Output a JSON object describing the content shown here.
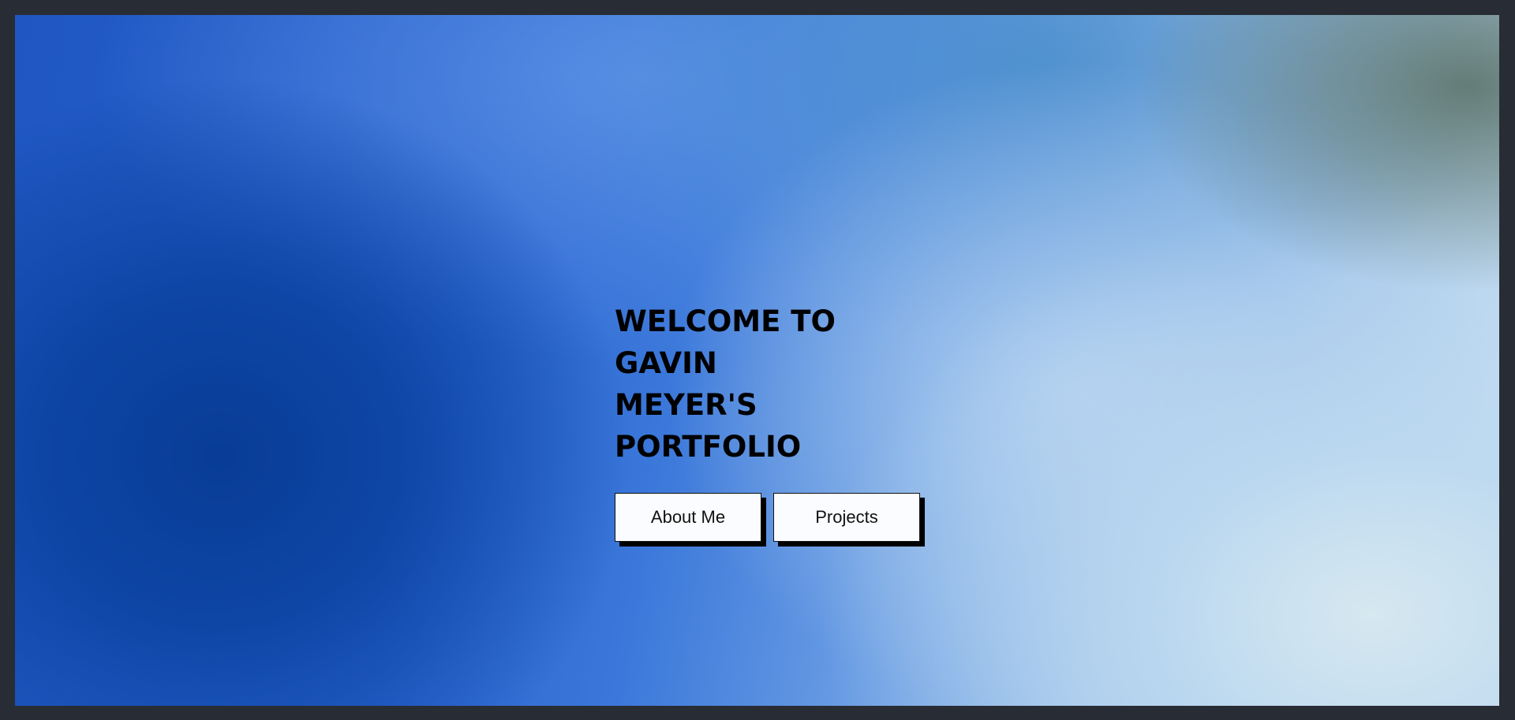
{
  "hero": {
    "title_line1": "WELCOME TO GAVIN",
    "title_line2": "MEYER'S PORTFOLIO"
  },
  "nav": {
    "about_label": "About Me",
    "projects_label": "Projects"
  },
  "colors": {
    "frame_border": "#282c34",
    "button_bg": "#fbfcff",
    "button_shadow": "#000000",
    "gradient_dark_blue": "#0a42a0",
    "gradient_light": "#d6e8f0"
  }
}
